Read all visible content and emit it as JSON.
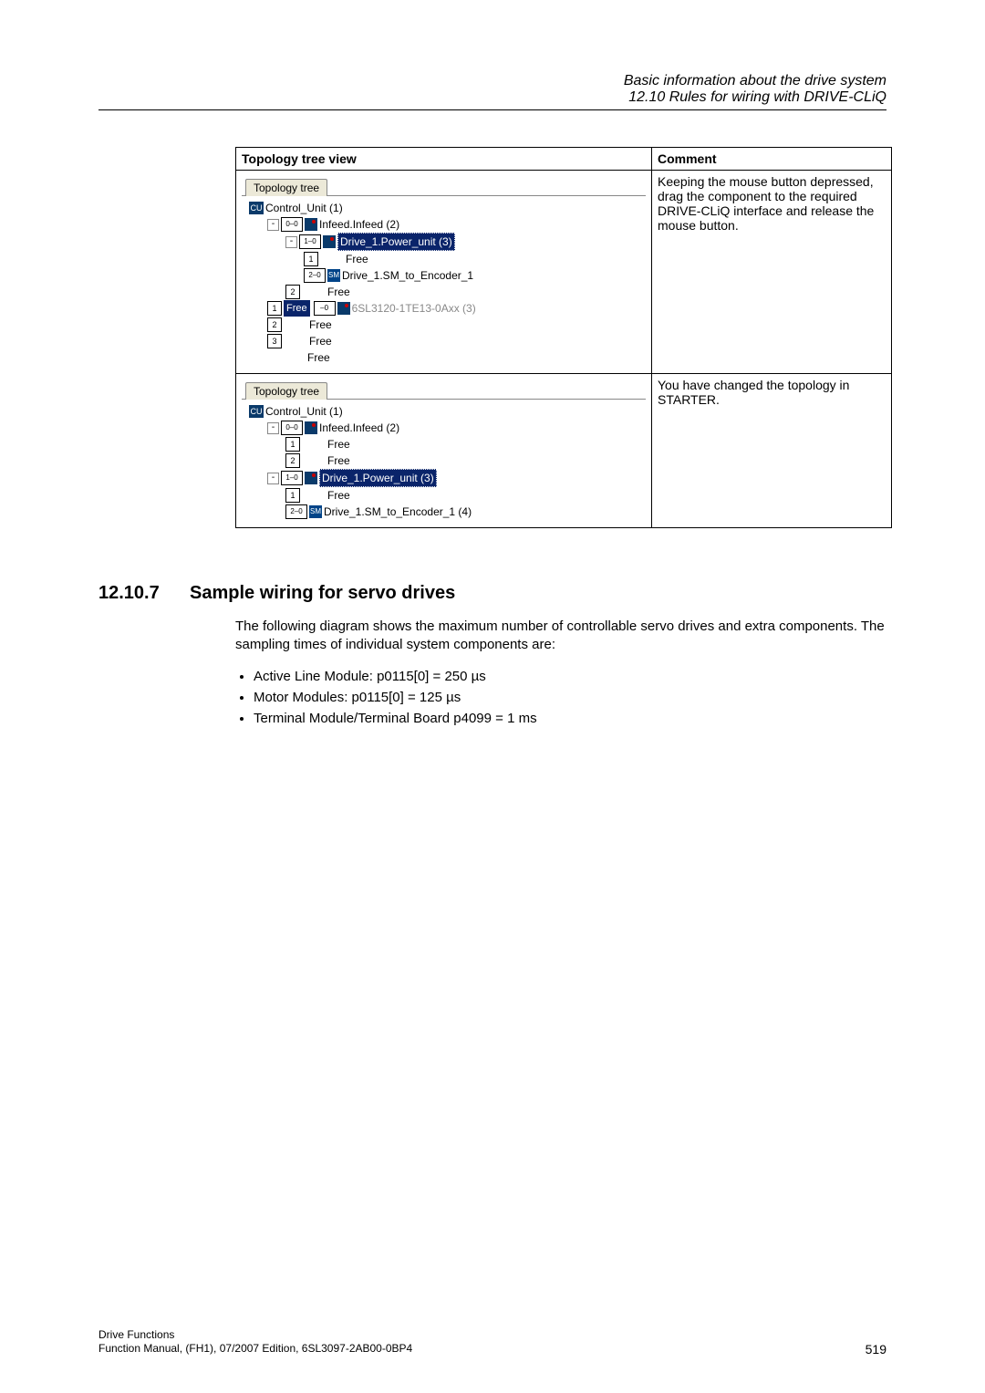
{
  "header": {
    "line1": "Basic information about the drive system",
    "line2": "12.10 Rules for wiring with DRIVE-CLiQ"
  },
  "table": {
    "col1_header": "Topology tree view",
    "col2_header": "Comment",
    "rows": [
      {
        "tab": "Topology tree",
        "tree": [
          {
            "indent": 0,
            "kind": "cu",
            "label": "Control_Unit (1)"
          },
          {
            "indent": 1,
            "kind": "infeed",
            "port": "0",
            "link": "0",
            "label": "Infeed.Infeed (2)"
          },
          {
            "indent": 2,
            "kind": "power_sel",
            "port": "1",
            "link": "0",
            "label": "Drive_1.Power_unit (3)"
          },
          {
            "indent": 3,
            "kind": "free",
            "port": "1",
            "label": "Free"
          },
          {
            "indent": 3,
            "kind": "sm",
            "port": "2",
            "link": "0",
            "label": "Drive_1.SM_to_Encoder_1"
          },
          {
            "indent": 2,
            "kind": "free",
            "port": "2",
            "label": "Free"
          },
          {
            "indent": 1,
            "kind": "drag",
            "port": "1",
            "badge": "Free",
            "link": "0",
            "label": "6SL3120-1TE13-0Axx (3)"
          },
          {
            "indent": 1,
            "kind": "free",
            "port": "2",
            "label": "Free"
          },
          {
            "indent": 1,
            "kind": "free",
            "port": "3",
            "label": "Free"
          },
          {
            "indent": 1,
            "kind": "free_last",
            "label": "Free"
          }
        ],
        "comment": "Keeping the mouse button depressed, drag the component to the required DRIVE-CLiQ interface and release the mouse button."
      },
      {
        "tab": "Topology tree",
        "tree": [
          {
            "indent": 0,
            "kind": "cu",
            "label": "Control_Unit (1)"
          },
          {
            "indent": 1,
            "kind": "infeed",
            "port": "0",
            "link": "0",
            "label": "Infeed.Infeed (2)"
          },
          {
            "indent": 2,
            "kind": "free",
            "port": "1",
            "label": "Free"
          },
          {
            "indent": 2,
            "kind": "free",
            "port": "2",
            "label": "Free"
          },
          {
            "indent": 1,
            "kind": "power_sel",
            "port": "1",
            "link": "0",
            "label": "Drive_1.Power_unit (3)"
          },
          {
            "indent": 2,
            "kind": "free",
            "port": "1",
            "label": "Free"
          },
          {
            "indent": 2,
            "kind": "sm",
            "port": "2",
            "link": "0",
            "label": "Drive_1.SM_to_Encoder_1 (4)"
          }
        ],
        "comment": "You have changed the topology in STARTER."
      }
    ]
  },
  "section": {
    "number": "12.10.7",
    "title": "Sample wiring for servo drives",
    "intro": "The following diagram shows the maximum number of controllable servo drives and extra components. The sampling times of individual system components are:",
    "bullets": [
      "Active Line Module: p0115[0] = 250 µs",
      "Motor Modules: p0115[0] = 125 µs",
      "Terminal Module/Terminal Board p4099 = 1 ms"
    ]
  },
  "footer": {
    "left1": "Drive Functions",
    "left2": "Function Manual, (FH1), 07/2007 Edition, 6SL3097-2AB00-0BP4",
    "page": "519"
  },
  "icons": {
    "cu_label": "CU",
    "sm_label": "SM"
  }
}
